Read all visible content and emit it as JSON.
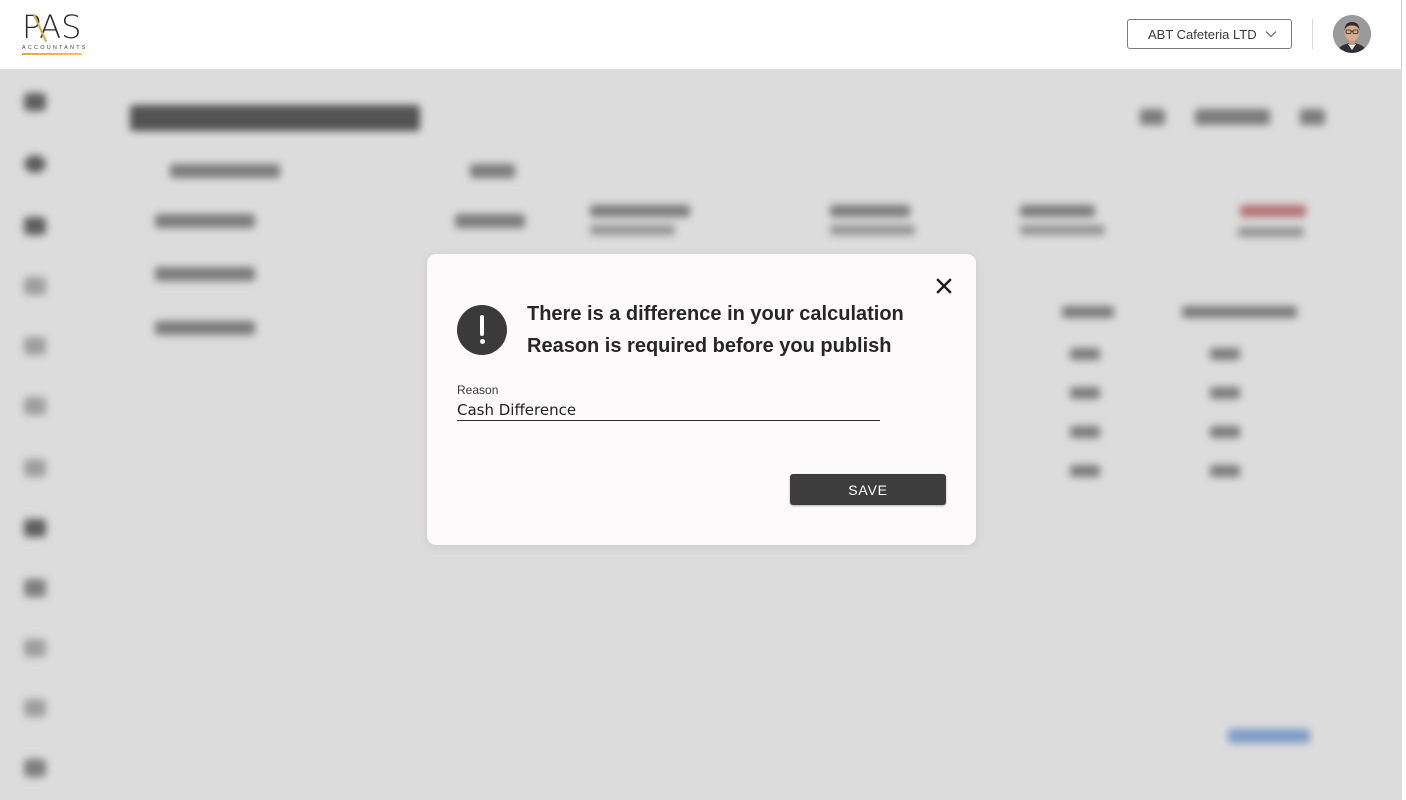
{
  "header": {
    "logo_text": "PAS",
    "logo_subtext": "ACCOUNTANTS",
    "company_select_value": "ABT Cafeteria LTD",
    "brand_color": "#e2a93a"
  },
  "dialog": {
    "message_line1": "There is a difference in your calculation",
    "message_line2": "Reason is required before you publish",
    "reason_label": "Reason",
    "reason_value": "Cash Difference",
    "save_label": "SAVE",
    "icon": "exclamation-circle-icon",
    "close_icon": "close-icon"
  }
}
